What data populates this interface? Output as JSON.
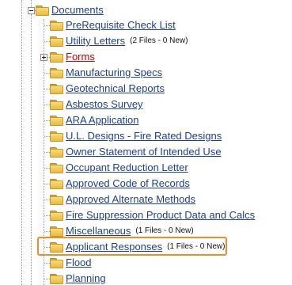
{
  "tree": {
    "root": {
      "label": "Documents",
      "expanded": true
    },
    "items": [
      {
        "id": "prerequisite",
        "label": "PreRequisite Check List",
        "count": "",
        "expandable": false
      },
      {
        "id": "utility",
        "label": "Utility Letters",
        "count": "(2 Files - 0 New)",
        "expandable": false
      },
      {
        "id": "forms",
        "label": "Forms",
        "count": "",
        "expandable": true,
        "color": "#cc0000"
      },
      {
        "id": "manufacturing",
        "label": "Manufacturing Specs",
        "count": "",
        "expandable": false
      },
      {
        "id": "geotechnical",
        "label": "Geotechnical Reports",
        "count": "",
        "expandable": false
      },
      {
        "id": "asbestos",
        "label": "Asbestos Survey",
        "count": "",
        "expandable": false
      },
      {
        "id": "ara",
        "label": "ARA Application",
        "count": "",
        "expandable": false
      },
      {
        "id": "ul-designs",
        "label": "U.L. Designs - Fire Rated Designs",
        "count": "",
        "expandable": false
      },
      {
        "id": "owner-statement",
        "label": "Owner Statement of Intended Use",
        "count": "",
        "expandable": false
      },
      {
        "id": "occupant-reduction",
        "label": "Occupant Reduction Letter",
        "count": "",
        "expandable": false
      },
      {
        "id": "approved-code",
        "label": "Approved Code of Records",
        "count": "",
        "expandable": false
      },
      {
        "id": "approved-alternate",
        "label": "Approved Alternate Methods",
        "count": "",
        "expandable": false
      },
      {
        "id": "fire-suppression",
        "label": "Fire Suppression Product Data and Calcs",
        "count": "",
        "expandable": false
      },
      {
        "id": "miscellaneous",
        "label": "Miscellaneous",
        "count": "(1 Files - 0 New)",
        "expandable": false
      },
      {
        "id": "applicant-responses",
        "label": "Applicant Responses",
        "count": "(1 Files - 0 New)",
        "expandable": false,
        "highlighted": true
      },
      {
        "id": "flood",
        "label": "Flood",
        "count": "",
        "expandable": false
      },
      {
        "id": "planning",
        "label": "Planning",
        "count": "",
        "expandable": false
      }
    ]
  },
  "colors": {
    "link": "#1f3f8f",
    "link_alert": "#cc0000",
    "highlight_border": "#f28c28",
    "folder": "#eab93e"
  },
  "icons": {
    "folder": "folder-icon",
    "expand": "expand-icon",
    "collapse": "collapse-icon"
  }
}
